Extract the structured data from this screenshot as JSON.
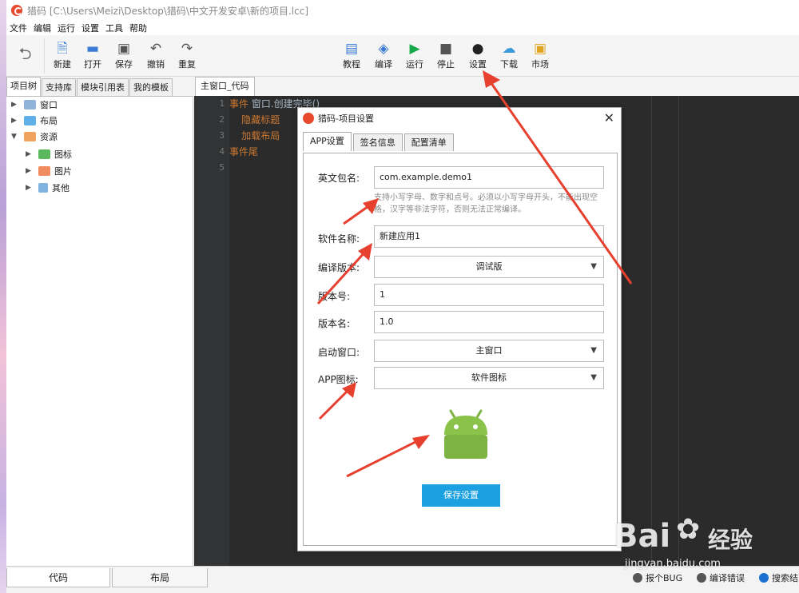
{
  "window": {
    "title": "猎码 [C:\\Users\\Meizi\\Desktop\\猎码\\中文开发安卓\\新的项目.lcc]"
  },
  "menu": [
    "文件",
    "编辑",
    "运行",
    "设置",
    "工具",
    "帮助"
  ],
  "toolbar": {
    "left": [
      {
        "label": "新建",
        "icon": "new-file-icon"
      },
      {
        "label": "打开",
        "icon": "folder-open-icon"
      },
      {
        "label": "保存",
        "icon": "save-icon"
      },
      {
        "label": "撤销",
        "icon": "undo-icon"
      },
      {
        "label": "重复",
        "icon": "redo-icon"
      }
    ],
    "center": [
      {
        "label": "教程",
        "icon": "tutorial-icon"
      },
      {
        "label": "编译",
        "icon": "layers-icon"
      },
      {
        "label": "运行",
        "icon": "play-icon"
      },
      {
        "label": "停止",
        "icon": "stop-icon"
      },
      {
        "label": "设置",
        "icon": "wrench-icon"
      },
      {
        "label": "下载",
        "icon": "cloud-download-icon"
      },
      {
        "label": "市场",
        "icon": "shop-icon"
      }
    ]
  },
  "left_tabs": [
    "项目树",
    "支持库",
    "模块引用表",
    "我的模板"
  ],
  "tree": [
    {
      "label": "窗口",
      "level": 0,
      "color": "#8fb3d9"
    },
    {
      "label": "布局",
      "level": 0,
      "color": "#5fb0e8"
    },
    {
      "label": "资源",
      "level": 0,
      "color": "#f0a35e"
    },
    {
      "label": "图标",
      "level": 1,
      "color": "#5cb85c"
    },
    {
      "label": "图片",
      "level": 1,
      "color": "#f08c5e"
    },
    {
      "label": "其他",
      "level": 1,
      "color": "#7fb3e0"
    }
  ],
  "editor": {
    "tab": "主窗口_代码",
    "line_numbers": [
      "1",
      "2",
      "3",
      "4",
      "5"
    ],
    "lines": [
      {
        "kw": "事件",
        "text": " 窗口.创建完毕()"
      },
      {
        "kw": "",
        "text": "    隐藏标题"
      },
      {
        "kw": "",
        "text": "    加载布局"
      },
      {
        "kw": "事件尾",
        "text": ""
      },
      {
        "kw": "",
        "text": ""
      }
    ]
  },
  "dialog": {
    "title": "猎码-项目设置",
    "tabs": [
      "APP设置",
      "签名信息",
      "配置清单"
    ],
    "fields": {
      "package_label": "英文包名:",
      "package_value": "com.example.demo1",
      "package_hint": "支持小写字母、数字和点号。必须以小写字母开头，不能出现空格，汉字等非法字符，否则无法正常编译。",
      "app_name_label": "软件名称:",
      "app_name_value": "新建应用1",
      "build_label": "编译版本:",
      "build_value": "调试版",
      "version_code_label": "版本号:",
      "version_code_value": "1",
      "version_name_label": "版本名:",
      "version_name_value": "1.0",
      "start_window_label": "启动窗口:",
      "start_window_value": "主窗口",
      "app_icon_label": "APP图标:",
      "app_icon_value": "软件图标"
    },
    "save_button": "保存设置"
  },
  "bottom_tabs": [
    "代码",
    "布局"
  ],
  "status": [
    {
      "label": "报个BUG",
      "icon": "bug-icon"
    },
    {
      "label": "编译错误",
      "icon": "gear-icon"
    },
    {
      "label": "搜索结",
      "icon": "search-icon"
    }
  ],
  "watermark": {
    "brand": "Bai",
    "brand2": "经验",
    "url": "jingyan.baidu.com"
  },
  "colors": {
    "accent": "#1ba1e2",
    "arrow": "#e8402f",
    "editor_bg": "#2b2b2b",
    "keyword": "#cc7832",
    "android_green": "#7cb342"
  }
}
